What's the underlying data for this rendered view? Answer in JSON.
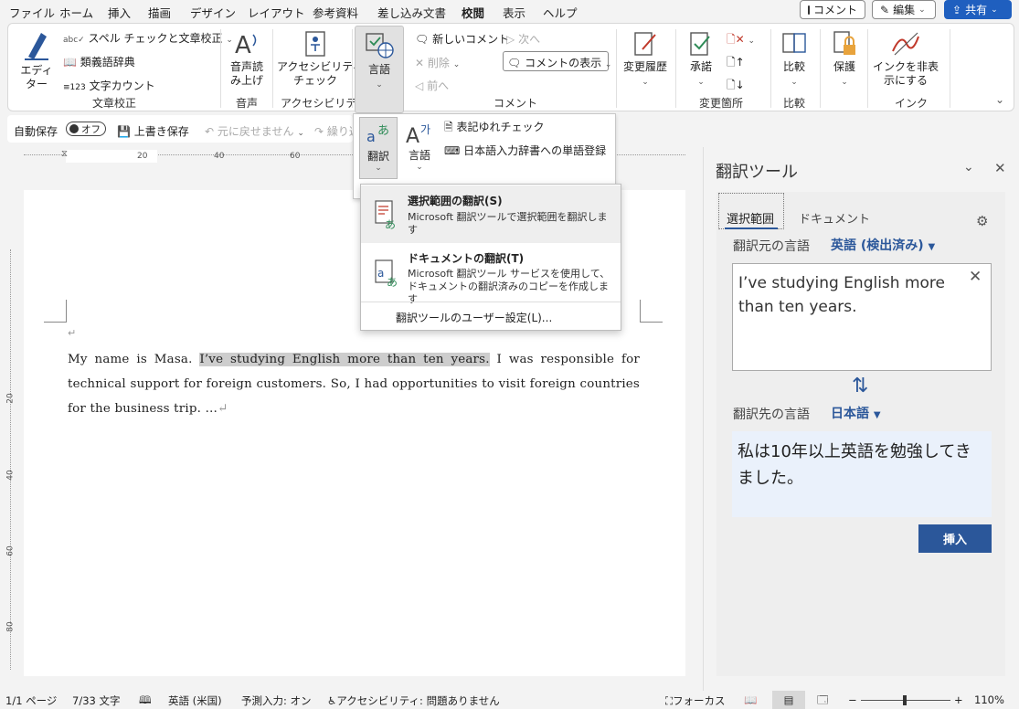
{
  "menu": {
    "tabs": [
      "ファイル",
      "ホーム",
      "挿入",
      "描画",
      "デザイン",
      "レイアウト",
      "参考資料",
      "差し込み文書",
      "校閲",
      "表示",
      "ヘルプ"
    ],
    "active_tab": "校閲",
    "comment_btn": "コメント",
    "edit_btn": "編集",
    "share_btn": "共有"
  },
  "ribbon": {
    "editor": "エディ\nター",
    "spell": "スペル チェックと文章校正",
    "thesaurus": "類義語辞典",
    "wordcount": "文字カウント",
    "group_proofing": "文章校正",
    "read_aloud": "音声読\nみ上げ",
    "group_speech": "音声",
    "accessibility_check": "アクセシビリティ\nチェック",
    "group_accessibility": "アクセシビリティ",
    "language": "言語",
    "new_comment": "新しいコメント",
    "delete": "削除",
    "prev": "前へ",
    "next": "次へ",
    "show_comments": "コメントの表示",
    "group_comments": "コメント",
    "track_changes": "変更履歴",
    "accept": "承諾",
    "group_changes": "変更箇所",
    "compare": "比較",
    "group_compare": "比較",
    "protect": "保護",
    "hide_ink": "インクを非表\n示にする",
    "group_ink": "インク"
  },
  "qat": {
    "autosave": "自動保存",
    "toggle": "オフ",
    "save": "上書き保存",
    "undo": "元に戻せません",
    "redo": "繰り返"
  },
  "lang_menu": {
    "translate": "翻訳",
    "language": "言語",
    "consistency": "表記ゆれチェック",
    "ime_register": "日本語入力辞書への単語登録"
  },
  "translate_menu": {
    "sel_title": "選択範囲の翻訳(S)",
    "sel_desc": "Microsoft 翻訳ツールで選択範囲を翻訳します",
    "doc_title": "ドキュメントの翻訳(T)",
    "doc_desc": "Microsoft 翻訳ツール サービスを使用して、ドキュメントの翻訳済みのコピーを作成します",
    "prefs": "翻訳ツールのユーザー設定(L)..."
  },
  "ruler": {
    "h_labels": [
      "20",
      "40",
      "60"
    ],
    "v_labels": [
      "20",
      "40",
      "60",
      "80"
    ]
  },
  "document": {
    "before": "My name is Masa. ",
    "selected": "I’ve studying English more than ten years.",
    "after": " I was responsible for technical support for foreign customers. So, I had opportunities to visit foreign countries for the business trip. …"
  },
  "pane": {
    "title": "翻訳ツール",
    "tab_selection": "選択範囲",
    "tab_document": "ドキュメント",
    "source_label": "翻訳元の言語",
    "source_lang": "英語 (検出済み)",
    "source_text": "I’ve studying English more than ten years.",
    "target_label": "翻訳先の言語",
    "target_lang": "日本語",
    "target_text": "私は10年以上英語を勉強してきました。",
    "insert": "挿入"
  },
  "status": {
    "page": "1/1 ページ",
    "words": "7/33 文字",
    "lang": "英語 (米国)",
    "predict": "予測入力: オン",
    "access": "アクセシビリティ: 問題ありません",
    "focus": "フォーカス",
    "zoom": "110%"
  },
  "colors": {
    "accent": "#2b579a",
    "share": "#1f5fbf",
    "highlight": "#cdcdcd"
  }
}
